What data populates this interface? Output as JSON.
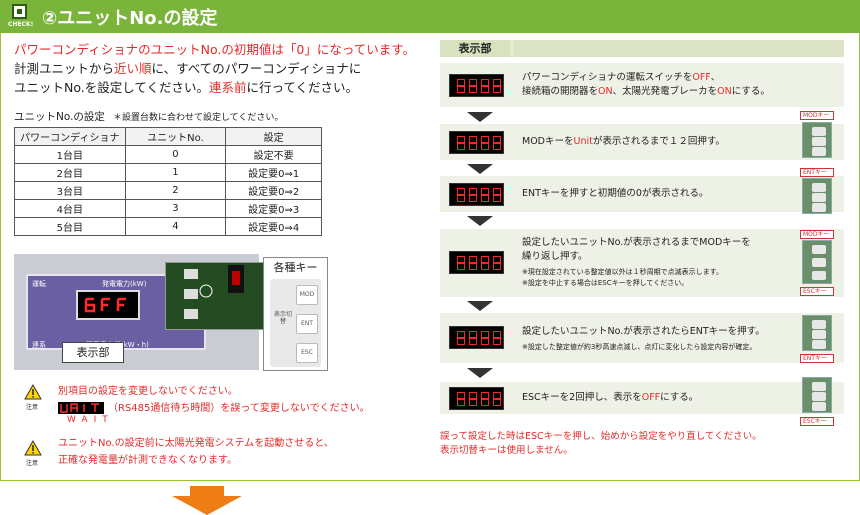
{
  "header": {
    "badge": "CHECK!",
    "title": "②ユニットNo.の設定"
  },
  "intro": {
    "line1_red": "パワーコンディショナのユニットNo.の初期値は「0」になっています。",
    "line2_a": "計測ユニットから",
    "line2_red": "近い順",
    "line2_b": "に、すべてのパワーコンディショナに",
    "line3_a": "ユニットNo.を設定してください。",
    "line3_red": "連系前",
    "line3_b": "に行ってください。"
  },
  "table": {
    "title": "ユニットNo.の設定",
    "note": "＊設置台数に合わせて設定してください。",
    "headers": [
      "パワーコンディショナ",
      "ユニットNo.",
      "設定"
    ],
    "rows": [
      [
        "1台目",
        "0",
        "設定不要"
      ],
      [
        "2台目",
        "1",
        "設定要0⇒1"
      ],
      [
        "3台目",
        "2",
        "設定要0⇒2"
      ],
      [
        "4台目",
        "3",
        "設定要0⇒3"
      ],
      [
        "5台目",
        "4",
        "設定要0⇒4"
      ]
    ]
  },
  "photo": {
    "label_unten": "運転",
    "label_power": "発電電力(kW)",
    "label_renkei": "連系",
    "label_total": "積算電力量(kW・h)",
    "tag": "表示部",
    "keys_title": "各種キー",
    "key_mod": "MOD",
    "key_switch": "表示切替",
    "key_ent": "ENT",
    "key_esc": "ESC"
  },
  "warnings": [
    {
      "icon_label": "注意",
      "text_red": "別項目の設定を変更しないでください。",
      "text2": "（RS485通信待ち時間）を誤って変更しないでください。",
      "wait": "WAIT"
    },
    {
      "icon_label": "注意",
      "text_red": "ユニットNo.の設定前に太陽光発電システムを起動させると、",
      "text_red2": "正確な発電量が計測できなくなります。"
    }
  ],
  "right": {
    "head": "表示部",
    "steps": [
      {
        "t1": "パワーコンディショナの運転スイッチを",
        "r1": "OFF",
        "t2": "、",
        "t3": "接続箱の開閉器を",
        "r2": "ON",
        "t4": "、太陽光発電ブレーカを",
        "r3": "ON",
        "t5": "にする。"
      },
      {
        "t1": "MODキーを",
        "r1": "Unit",
        "t2": "が表示されるまで１２回押す。",
        "key": "MODキー"
      },
      {
        "t1": "ENTキーを押すと初期値の0が表示される。",
        "key": "ENTキー"
      },
      {
        "t1": "設定したいユニットNo.が表示されるまでMODキーを",
        "t2": "繰り返し押す。",
        "s1": "※現在設定されている整定値以外は１秒周期で点滅表示します。",
        "s2": "※設定を中止する場合はESCキーを押してください。",
        "key1": "MODキー",
        "key2": "ESCキー"
      },
      {
        "t1": "設定したいユニットNo.が表示されたらENTキーを押す。",
        "s1": "※設定した整定値が約3秒高速点滅し、点灯に変化したら設定内容が確定。",
        "key": "ENTキー"
      },
      {
        "t1": "ESCキーを2回押し、表示を",
        "r1": "OFF",
        "t2": "にする。",
        "key": "ESCキー"
      }
    ],
    "foot1": "誤って設定した時はESCキーを押し、始めから設定をやり直してください。",
    "foot2": "表示切替キーは使用しません。"
  }
}
